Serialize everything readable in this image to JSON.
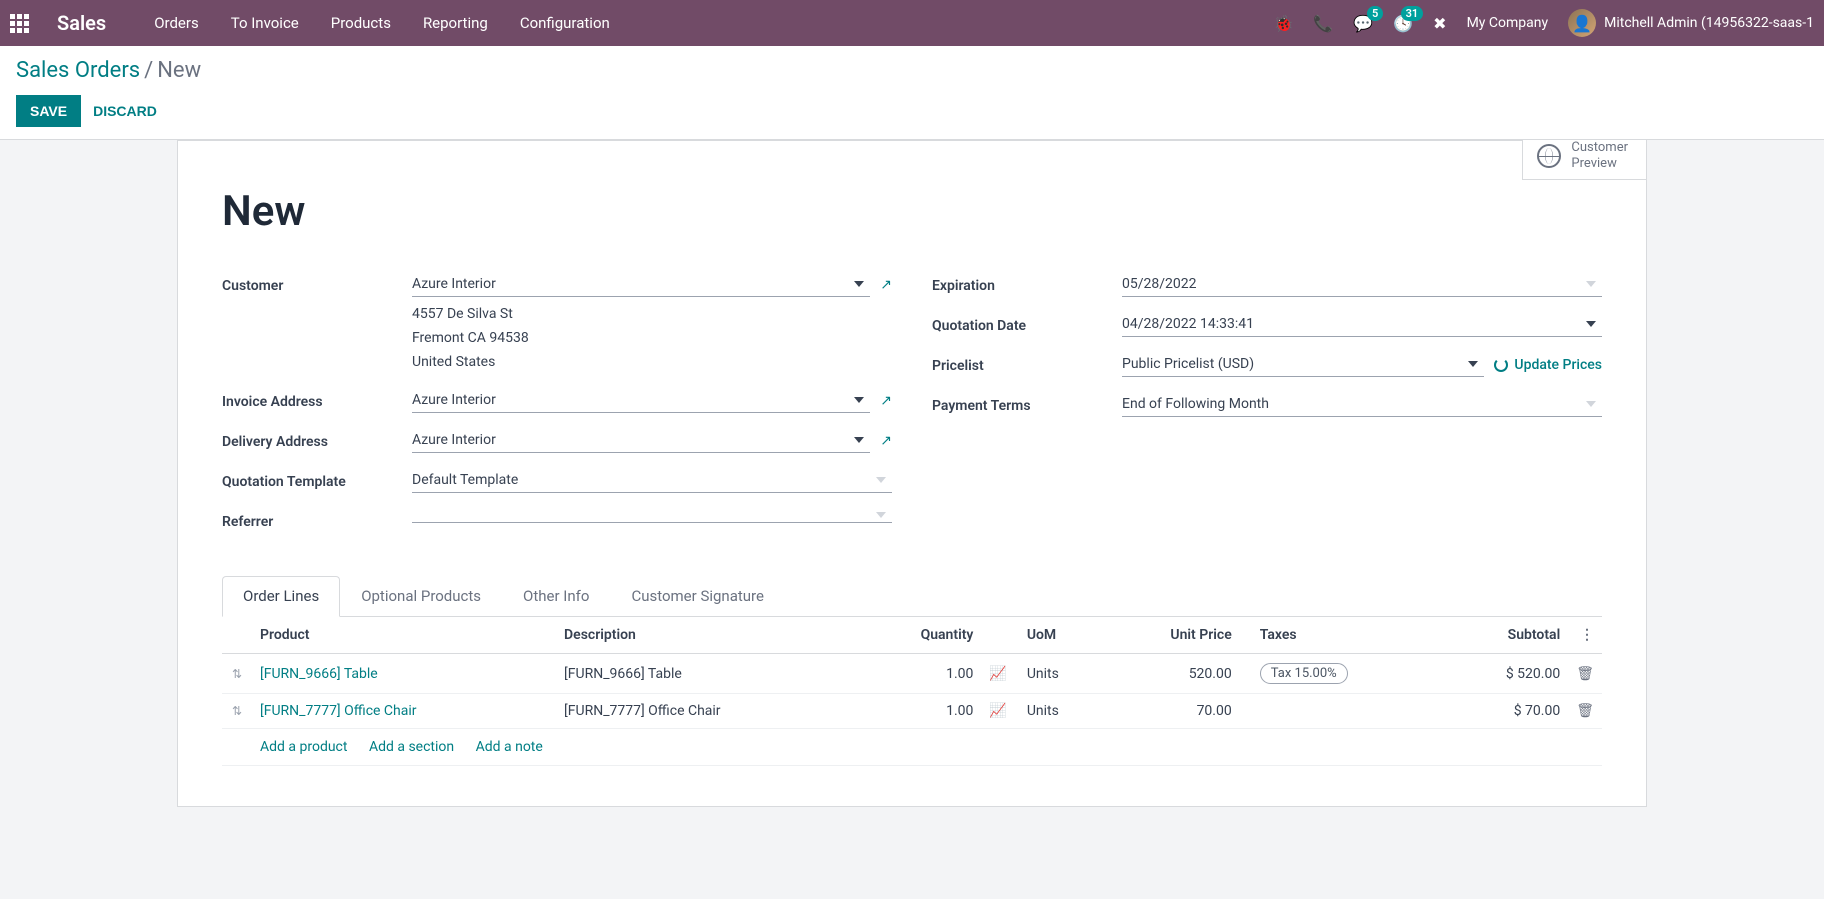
{
  "navbar": {
    "brand": "Sales",
    "menu": [
      "Orders",
      "To Invoice",
      "Products",
      "Reporting",
      "Configuration"
    ],
    "messages_badge": "5",
    "activities_badge": "31",
    "company": "My Company",
    "user": "Mitchell Admin (14956322-saas-1"
  },
  "breadcrumb": {
    "parent": "Sales Orders",
    "current": "New"
  },
  "actions": {
    "save": "Save",
    "discard": "Discard"
  },
  "stat_button": {
    "line1": "Customer",
    "line2": "Preview"
  },
  "title": "New",
  "left": {
    "customer_label": "Customer",
    "customer": "Azure Interior",
    "address_l1": "4557 De Silva St",
    "address_l2": "Fremont CA 94538",
    "address_l3": "United States",
    "invoice_label": "Invoice Address",
    "invoice": "Azure Interior",
    "delivery_label": "Delivery Address",
    "delivery": "Azure Interior",
    "template_label": "Quotation Template",
    "template": "Default Template",
    "referrer_label": "Referrer",
    "referrer": ""
  },
  "right": {
    "expiration_label": "Expiration",
    "expiration": "05/28/2022",
    "qdate_label": "Quotation Date",
    "qdate": "04/28/2022 14:33:41",
    "pricelist_label": "Pricelist",
    "pricelist": "Public Pricelist (USD)",
    "update_prices": "Update Prices",
    "terms_label": "Payment Terms",
    "terms": "End of Following Month"
  },
  "tabs": [
    "Order Lines",
    "Optional Products",
    "Other Info",
    "Customer Signature"
  ],
  "table": {
    "headers": {
      "product": "Product",
      "description": "Description",
      "qty": "Quantity",
      "uom": "UoM",
      "unit_price": "Unit Price",
      "taxes": "Taxes",
      "subtotal": "Subtotal"
    },
    "rows": [
      {
        "product": "[FURN_9666] Table",
        "description": "[FURN_9666] Table",
        "qty": "1.00",
        "uom": "Units",
        "unit_price": "520.00",
        "tax": "Tax 15.00%",
        "subtotal": "$ 520.00"
      },
      {
        "product": "[FURN_7777] Office Chair",
        "description": "[FURN_7777] Office Chair",
        "qty": "1.00",
        "uom": "Units",
        "unit_price": "70.00",
        "tax": "",
        "subtotal": "$ 70.00"
      }
    ],
    "add_product": "Add a product",
    "add_section": "Add a section",
    "add_note": "Add a note"
  }
}
